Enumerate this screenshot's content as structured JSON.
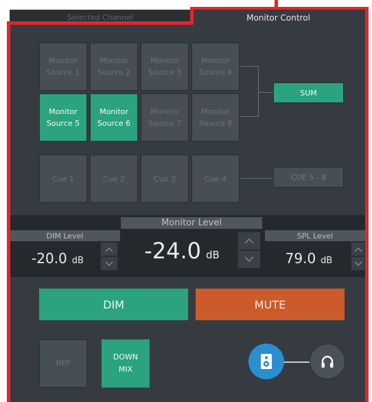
{
  "tabs": {
    "inactive": "Selected Channel",
    "active": "Monitor Control"
  },
  "sources": [
    {
      "line1": "Monitor",
      "line2": "Source 1",
      "active": false
    },
    {
      "line1": "Monitor",
      "line2": "Source 2",
      "active": false
    },
    {
      "line1": "Monitor",
      "line2": "Source 3",
      "active": false
    },
    {
      "line1": "Monitor",
      "line2": "Source 4",
      "active": false
    },
    {
      "line1": "Monitor",
      "line2": "Source 5",
      "active": true
    },
    {
      "line1": "Monitor",
      "line2": "Source 6",
      "active": true
    },
    {
      "line1": "Monitor",
      "line2": "Source 7",
      "active": false
    },
    {
      "line1": "Monitor",
      "line2": "Source 8",
      "active": false
    }
  ],
  "sum_label": "SUM",
  "cues": [
    "Cue 1",
    "Cue 2",
    "Cue 3",
    "Cue 4"
  ],
  "cue_group_label": "CUE 5 - 8",
  "levels": {
    "dim": {
      "label": "DIM Level",
      "value": "-20.0",
      "unit": "dB"
    },
    "monitor": {
      "label": "Monitor Level",
      "value": "-24.0",
      "unit": "dB"
    },
    "spl": {
      "label": "SPL Level",
      "value": "79.0",
      "unit": "dB"
    }
  },
  "dim_label": "DIM",
  "mute_label": "MUTE",
  "ref_label": "REF",
  "downmix": {
    "line1": "DOWN",
    "line2": "MIX"
  },
  "icons": {
    "speaker": "speaker-icon",
    "headphones": "headphones-icon",
    "up": "chevron-up-icon",
    "down": "chevron-down-icon"
  },
  "colors": {
    "accent_green": "#2aa37e",
    "mute_orange": "#cc5a2b",
    "speaker_blue": "#2a8fd0",
    "highlight_red": "#e3262b"
  }
}
